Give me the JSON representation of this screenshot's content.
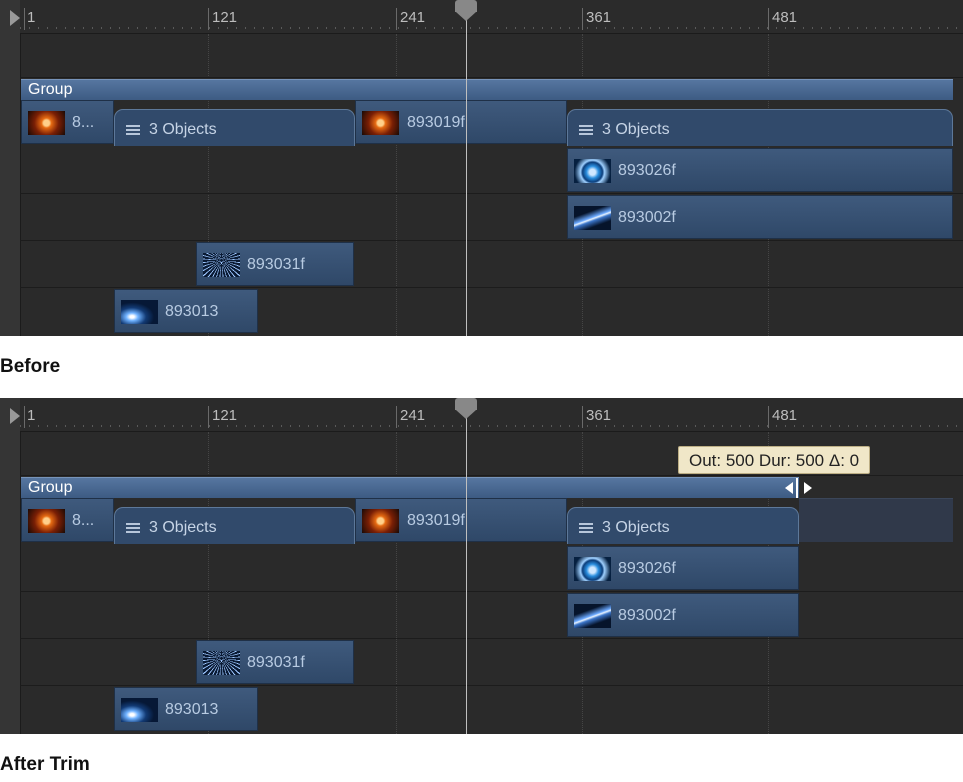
{
  "ruler_labels": [
    "1",
    "121",
    "241",
    "361",
    "481"
  ],
  "before": {
    "caption": "Before",
    "group_label": "Group",
    "clip_first": "8...",
    "objects_1": "3 Objects",
    "clip_a": "893019f",
    "objects_2": "3 Objects",
    "clip_b": "893026f",
    "clip_c": "893002f",
    "clip_d": "893031f",
    "clip_e": "893013"
  },
  "after": {
    "caption": "After Trim",
    "group_label": "Group",
    "clip_first": "8...",
    "objects_1": "3 Objects",
    "clip_a": "893019f",
    "objects_2": "3 Objects",
    "clip_b": "893026f",
    "clip_c": "893002f",
    "clip_d": "893031f",
    "clip_e": "893013",
    "tooltip": "Out: 500 Dur: 500 Δ: 0"
  },
  "icons": [
    "playhead-icon",
    "menu-lines-icon",
    "trim-cursor-icon",
    "play-start-icon"
  ]
}
